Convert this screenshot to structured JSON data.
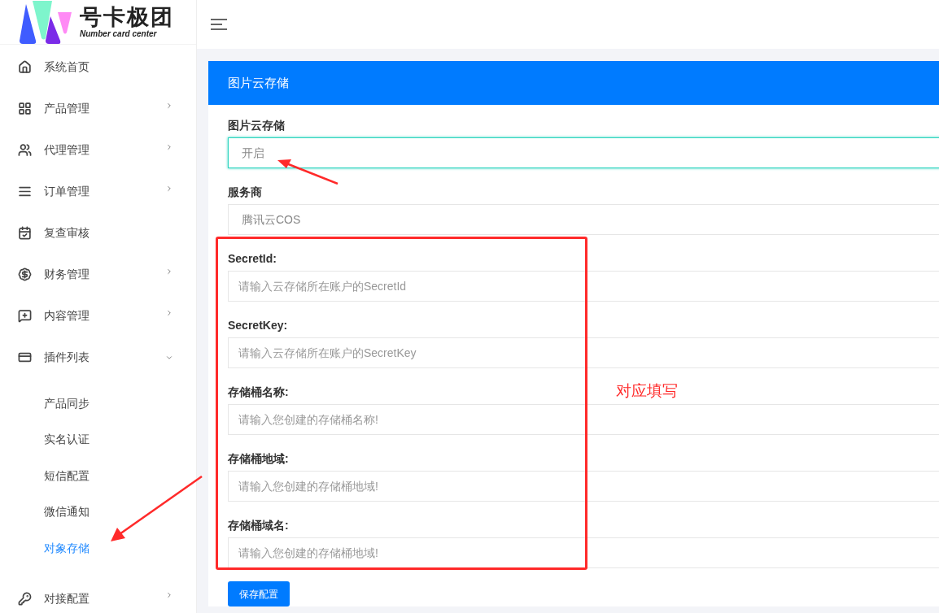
{
  "logo": {
    "title": "号卡极团",
    "subtitle": "Number card center"
  },
  "sidebar": {
    "items": [
      {
        "label": "系统首页"
      },
      {
        "label": "产品管理",
        "expanded": false
      },
      {
        "label": "代理管理",
        "expanded": false
      },
      {
        "label": "订单管理",
        "expanded": false
      },
      {
        "label": "复查审核"
      },
      {
        "label": "财务管理",
        "expanded": false
      },
      {
        "label": "内容管理",
        "expanded": false
      },
      {
        "label": "插件列表",
        "expanded": true,
        "children": [
          {
            "label": "产品同步",
            "selected": false
          },
          {
            "label": "实名认证",
            "selected": false
          },
          {
            "label": "短信配置",
            "selected": false
          },
          {
            "label": "微信通知",
            "selected": false
          },
          {
            "label": "对象存储",
            "selected": true
          }
        ]
      },
      {
        "label": "对接配置",
        "expanded": false
      }
    ]
  },
  "card": {
    "title": "图片云存储",
    "fields": [
      {
        "label": "图片云存储",
        "kind": "select",
        "value": "开启",
        "focused": true
      },
      {
        "label": "服务商",
        "kind": "select",
        "value": "腾讯云COS",
        "focused": false
      },
      {
        "label": "SecretId:",
        "kind": "input",
        "placeholder": "请输入云存储所在账户的SecretId",
        "focused": false
      },
      {
        "label": "SecretKey:",
        "kind": "input",
        "placeholder": "请输入云存储所在账户的SecretKey",
        "focused": false
      },
      {
        "label": "存储桶名称:",
        "kind": "input",
        "placeholder": "请输入您创建的存储桶名称!",
        "focused": false
      },
      {
        "label": "存储桶地域:",
        "kind": "input",
        "placeholder": "请输入您创建的存储桶地域!",
        "focused": false
      },
      {
        "label": "存储桶域名:",
        "kind": "input",
        "placeholder": "请输入您创建的存储桶地域!",
        "focused": false
      }
    ],
    "save_button": "保存配置"
  },
  "annotation": {
    "text": "对应填写"
  }
}
